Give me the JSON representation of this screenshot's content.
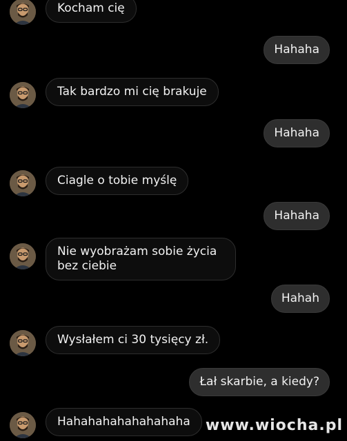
{
  "conversation": {
    "messages": [
      {
        "side": "in",
        "text": "Kocham cię"
      },
      {
        "side": "out",
        "text": "Hahaha"
      },
      {
        "side": "in",
        "text": "Tak bardzo mi cię brakuje"
      },
      {
        "side": "out",
        "text": "Hahaha"
      },
      {
        "side": "in",
        "text": "Ciagle o tobie myślę"
      },
      {
        "side": "out",
        "text": "Hahaha"
      },
      {
        "side": "in",
        "text": "Nie wyobrażam sobie życia bez ciebie"
      },
      {
        "side": "out",
        "text": "Hahah"
      },
      {
        "side": "in",
        "text": "Wysłałem ci 30 tysięcy zł."
      },
      {
        "side": "out",
        "text": "Łał skarbie, a kiedy?"
      },
      {
        "side": "in",
        "text": "Hahahahahahahahaha"
      }
    ]
  },
  "watermark": {
    "text": "www.wiocha.pl"
  },
  "colors": {
    "background": "#000000",
    "incoming_bubble": "#0d0d0d",
    "outgoing_bubble": "#2e2e2e",
    "text": "#f2f2f2"
  }
}
